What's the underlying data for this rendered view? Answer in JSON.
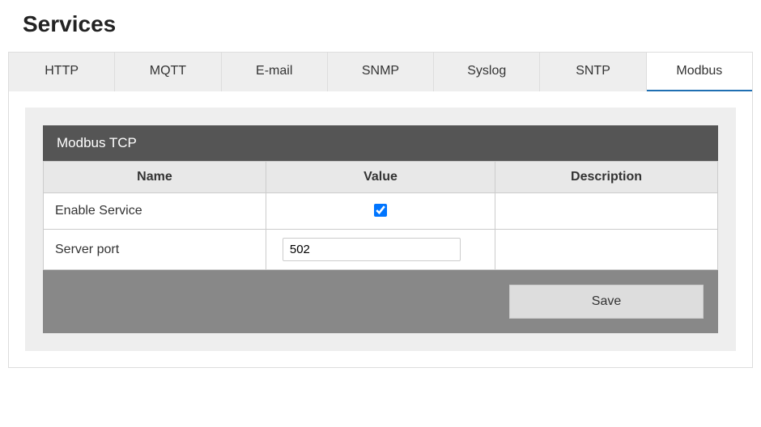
{
  "page": {
    "title": "Services"
  },
  "tabs": [
    {
      "label": "HTTP",
      "active": false
    },
    {
      "label": "MQTT",
      "active": false
    },
    {
      "label": "E-mail",
      "active": false
    },
    {
      "label": "SNMP",
      "active": false
    },
    {
      "label": "Syslog",
      "active": false
    },
    {
      "label": "SNTP",
      "active": false
    },
    {
      "label": "Modbus",
      "active": true
    }
  ],
  "panel": {
    "title": "Modbus TCP",
    "headers": {
      "name": "Name",
      "value": "Value",
      "description": "Description"
    },
    "rows": [
      {
        "name": "Enable Service",
        "type": "checkbox",
        "value": true,
        "description": ""
      },
      {
        "name": "Server port",
        "type": "text",
        "value": "502",
        "description": ""
      }
    ],
    "save_label": "Save"
  }
}
